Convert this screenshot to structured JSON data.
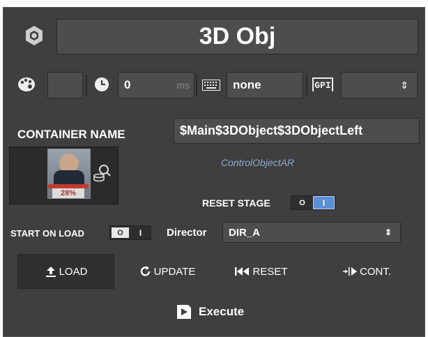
{
  "header": {
    "title": "3D Obj",
    "icon": "3d-object-icon"
  },
  "props": {
    "palette_icon": "palette-icon",
    "clock_icon": "clock-icon",
    "duration_value": "0",
    "duration_unit": "ms",
    "keyboard_icon": "keyboard-icon",
    "key_value": "none",
    "gpi_label": "GPI",
    "gpi_arrow": "⇕"
  },
  "container": {
    "label": "CONTAINER NAME",
    "value": "$Main$3DObject$3DObjectLeft"
  },
  "thumbnail": {
    "badge": "28%",
    "search_icon": "search-coins-icon"
  },
  "control_object": "ControlObjectAR",
  "reset_stage": {
    "label": "RESET STAGE",
    "off": "O",
    "on": "I",
    "state": "on"
  },
  "start_on_load": {
    "label": "START ON LOAD",
    "off": "O",
    "on": "I",
    "state": "off"
  },
  "director": {
    "label": "Director",
    "value": "DIR_A",
    "arrow": "⇕"
  },
  "actions": [
    {
      "label": "LOAD",
      "icon": "upload-icon"
    },
    {
      "label": "UPDATE",
      "icon": "refresh-icon"
    },
    {
      "label": "RESET",
      "icon": "rewind-icon"
    },
    {
      "label": "CONT.",
      "icon": "continue-icon"
    }
  ],
  "execute": {
    "label": "Execute",
    "icon": "execute-icon"
  },
  "colors": {
    "panel": "#3f3f3f",
    "field": "#4d4d4d",
    "accent": "#5b8fd6",
    "link": "#8ea9d0"
  }
}
